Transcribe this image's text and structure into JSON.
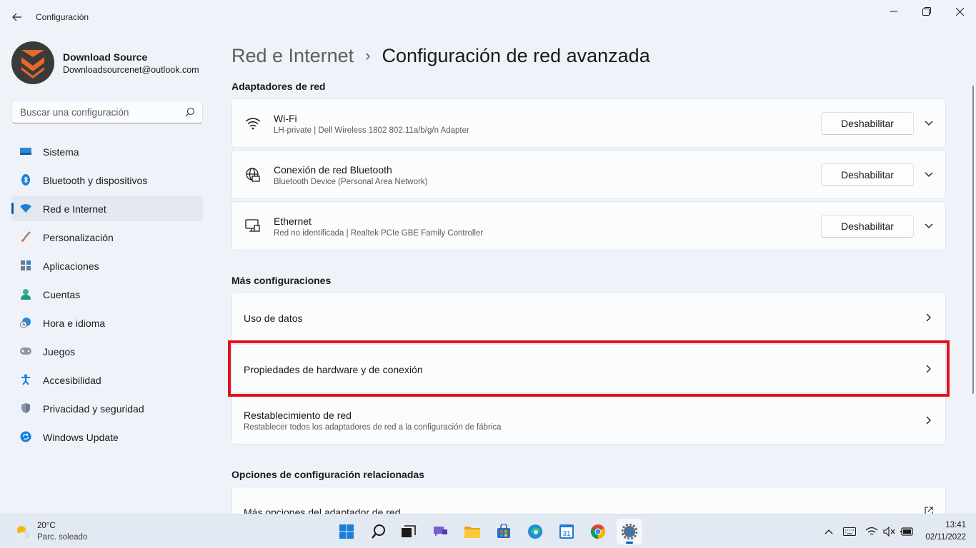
{
  "window": {
    "app_title": "Configuración"
  },
  "profile": {
    "name": "Download Source",
    "email": "Downloadsourcenet@outlook.com"
  },
  "search": {
    "placeholder": "Buscar una configuración"
  },
  "sidebar": {
    "items": [
      {
        "label": "Sistema",
        "icon": "monitor-icon"
      },
      {
        "label": "Bluetooth y dispositivos",
        "icon": "bluetooth-icon"
      },
      {
        "label": "Red e Internet",
        "icon": "wifi-icon",
        "active": true
      },
      {
        "label": "Personalización",
        "icon": "brush-icon"
      },
      {
        "label": "Aplicaciones",
        "icon": "apps-icon"
      },
      {
        "label": "Cuentas",
        "icon": "person-icon"
      },
      {
        "label": "Hora e idioma",
        "icon": "clock-globe-icon"
      },
      {
        "label": "Juegos",
        "icon": "gamepad-icon"
      },
      {
        "label": "Accesibilidad",
        "icon": "accessibility-icon"
      },
      {
        "label": "Privacidad y seguridad",
        "icon": "shield-icon"
      },
      {
        "label": "Windows Update",
        "icon": "update-icon"
      }
    ]
  },
  "breadcrumb": {
    "parent": "Red e Internet",
    "separator": "›",
    "current": "Configuración de red avanzada"
  },
  "adapters": {
    "section_title": "Adaptadores de red",
    "items": [
      {
        "title": "Wi-Fi",
        "subtitle": "LH-private | Dell Wireless 1802 802.11a/b/g/n Adapter",
        "button": "Deshabilitar",
        "icon": "wifi-icon"
      },
      {
        "title": "Conexión de red Bluetooth",
        "subtitle": "Bluetooth Device (Personal Area Network)",
        "button": "Deshabilitar",
        "icon": "globe-network-icon"
      },
      {
        "title": "Ethernet",
        "subtitle": "Red no identificada | Realtek PCIe GBE Family Controller",
        "button": "Deshabilitar",
        "icon": "ethernet-icon"
      }
    ]
  },
  "more_settings": {
    "section_title": "Más configuraciones",
    "items": [
      {
        "title": "Uso de datos"
      },
      {
        "title": "Propiedades de hardware y de conexión"
      },
      {
        "title": "Restablecimiento de red",
        "subtitle": "Restablecer todos los adaptadores de red a la configuración de fábrica"
      }
    ]
  },
  "related": {
    "section_title": "Opciones de configuración relacionadas",
    "items": [
      {
        "title": "Más opciones del adaptador de red"
      }
    ]
  },
  "taskbar": {
    "weather_temp": "20°C",
    "weather_desc": "Parc. soleado",
    "calendar_day": "31",
    "clock_time": "13:41",
    "clock_date": "02/11/2022"
  },
  "colors": {
    "accent": "#005fb8",
    "highlight": "#e0121b"
  }
}
